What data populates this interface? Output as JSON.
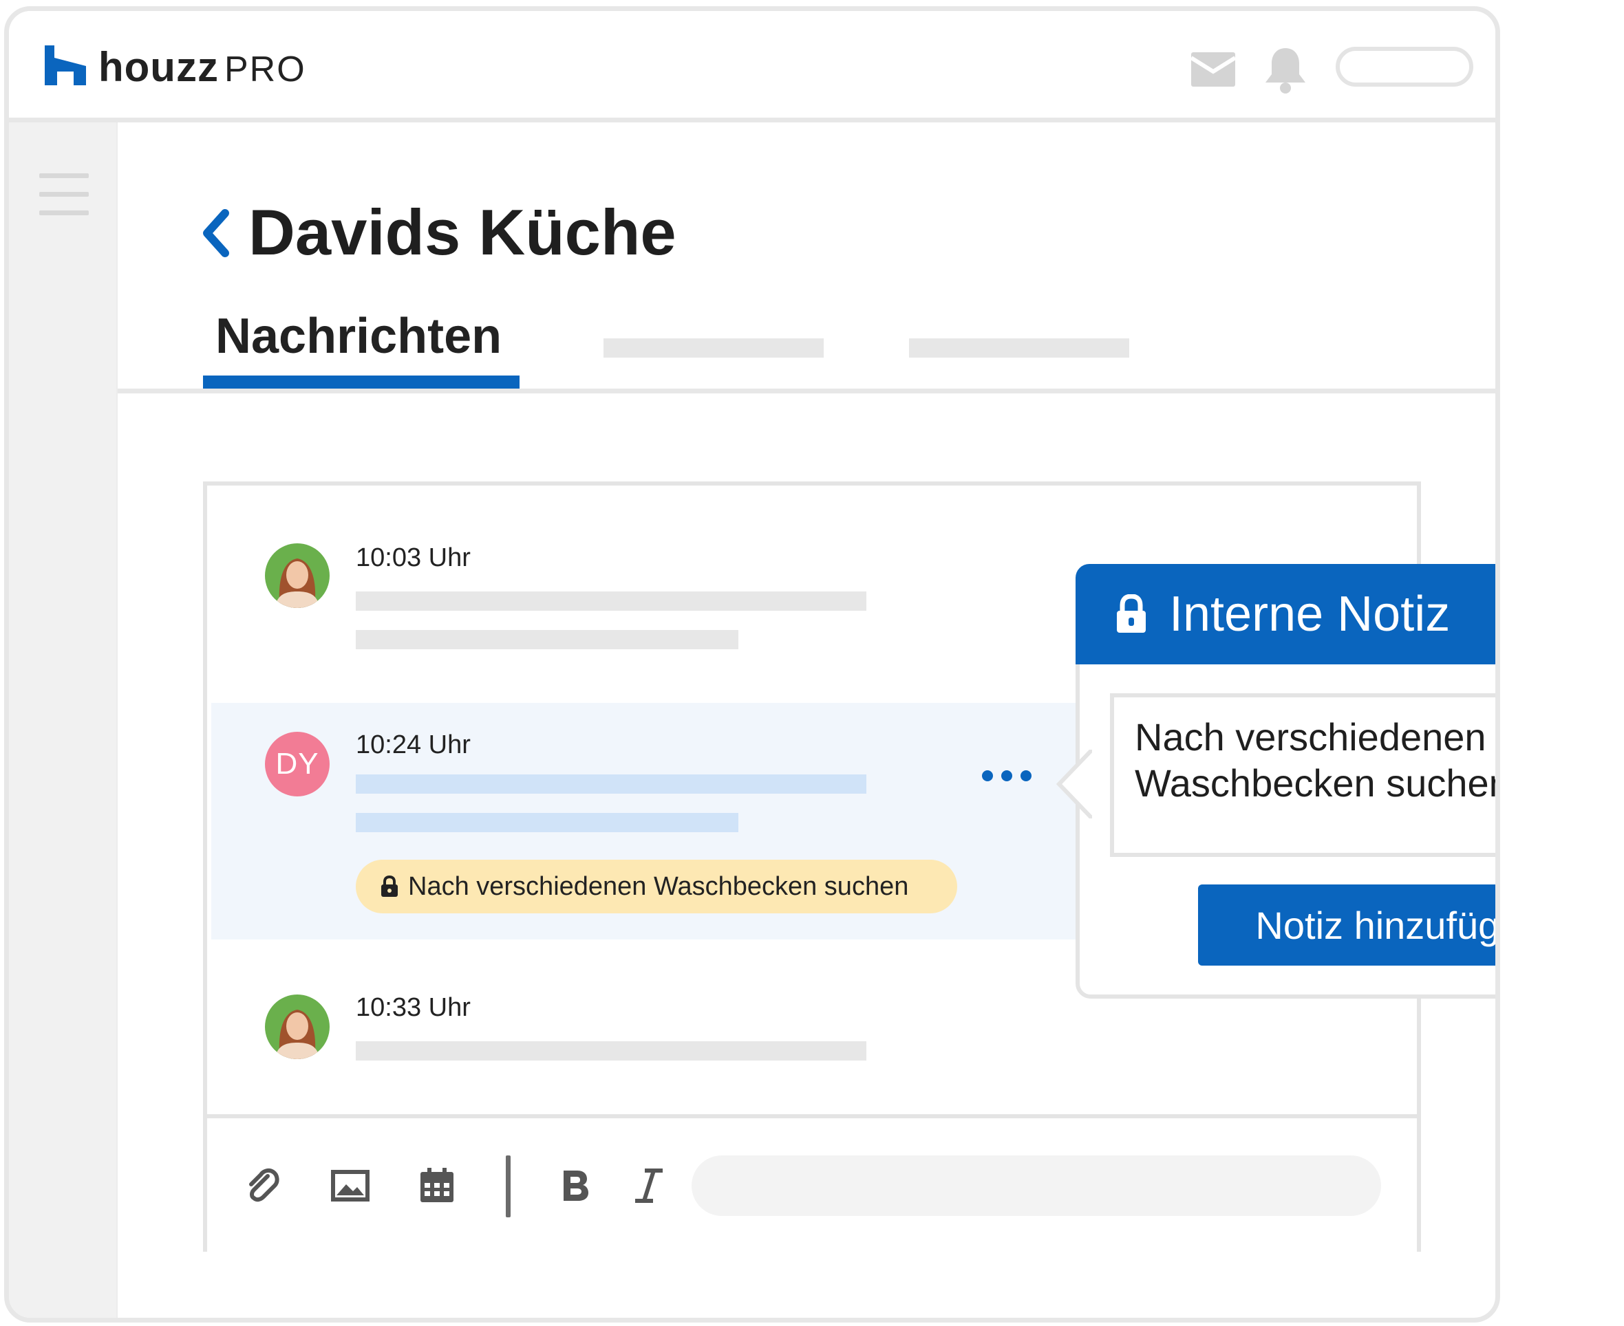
{
  "brand": {
    "name": "houzz",
    "suffix": "PRO",
    "logo_icon": "houzz-h-icon",
    "accent": "#0a65be"
  },
  "header_icons": [
    "mail-icon",
    "bell-icon"
  ],
  "sidebar": {
    "menu_icon": "hamburger-icon"
  },
  "page": {
    "title": "Davids Küche",
    "back_icon": "chevron-left-icon"
  },
  "tabs": [
    {
      "label": "Nachrichten",
      "active": true
    }
  ],
  "messages": [
    {
      "time": "10:03 Uhr",
      "avatar": "photo"
    },
    {
      "time": "10:24 Uhr",
      "avatar_initials": "DY",
      "note": "Nach verschiedenen Waschbecken suchen"
    },
    {
      "time": "10:33 Uhr",
      "avatar": "photo"
    }
  ],
  "composer": {
    "tools": [
      "paperclip-icon",
      "image-icon",
      "calendar-icon",
      "bold-icon",
      "italic-icon"
    ]
  },
  "popover": {
    "title": "Interne Notiz",
    "note_text": "Nach verschiedenen Waschbecken suchen",
    "button_label": "Notiz hinzufügen"
  },
  "colors": {
    "primary": "#0a65be",
    "note_chip": "#fde8b3",
    "avatar_dy": "#f27c95",
    "highlight_row": "#f1f6fc"
  }
}
